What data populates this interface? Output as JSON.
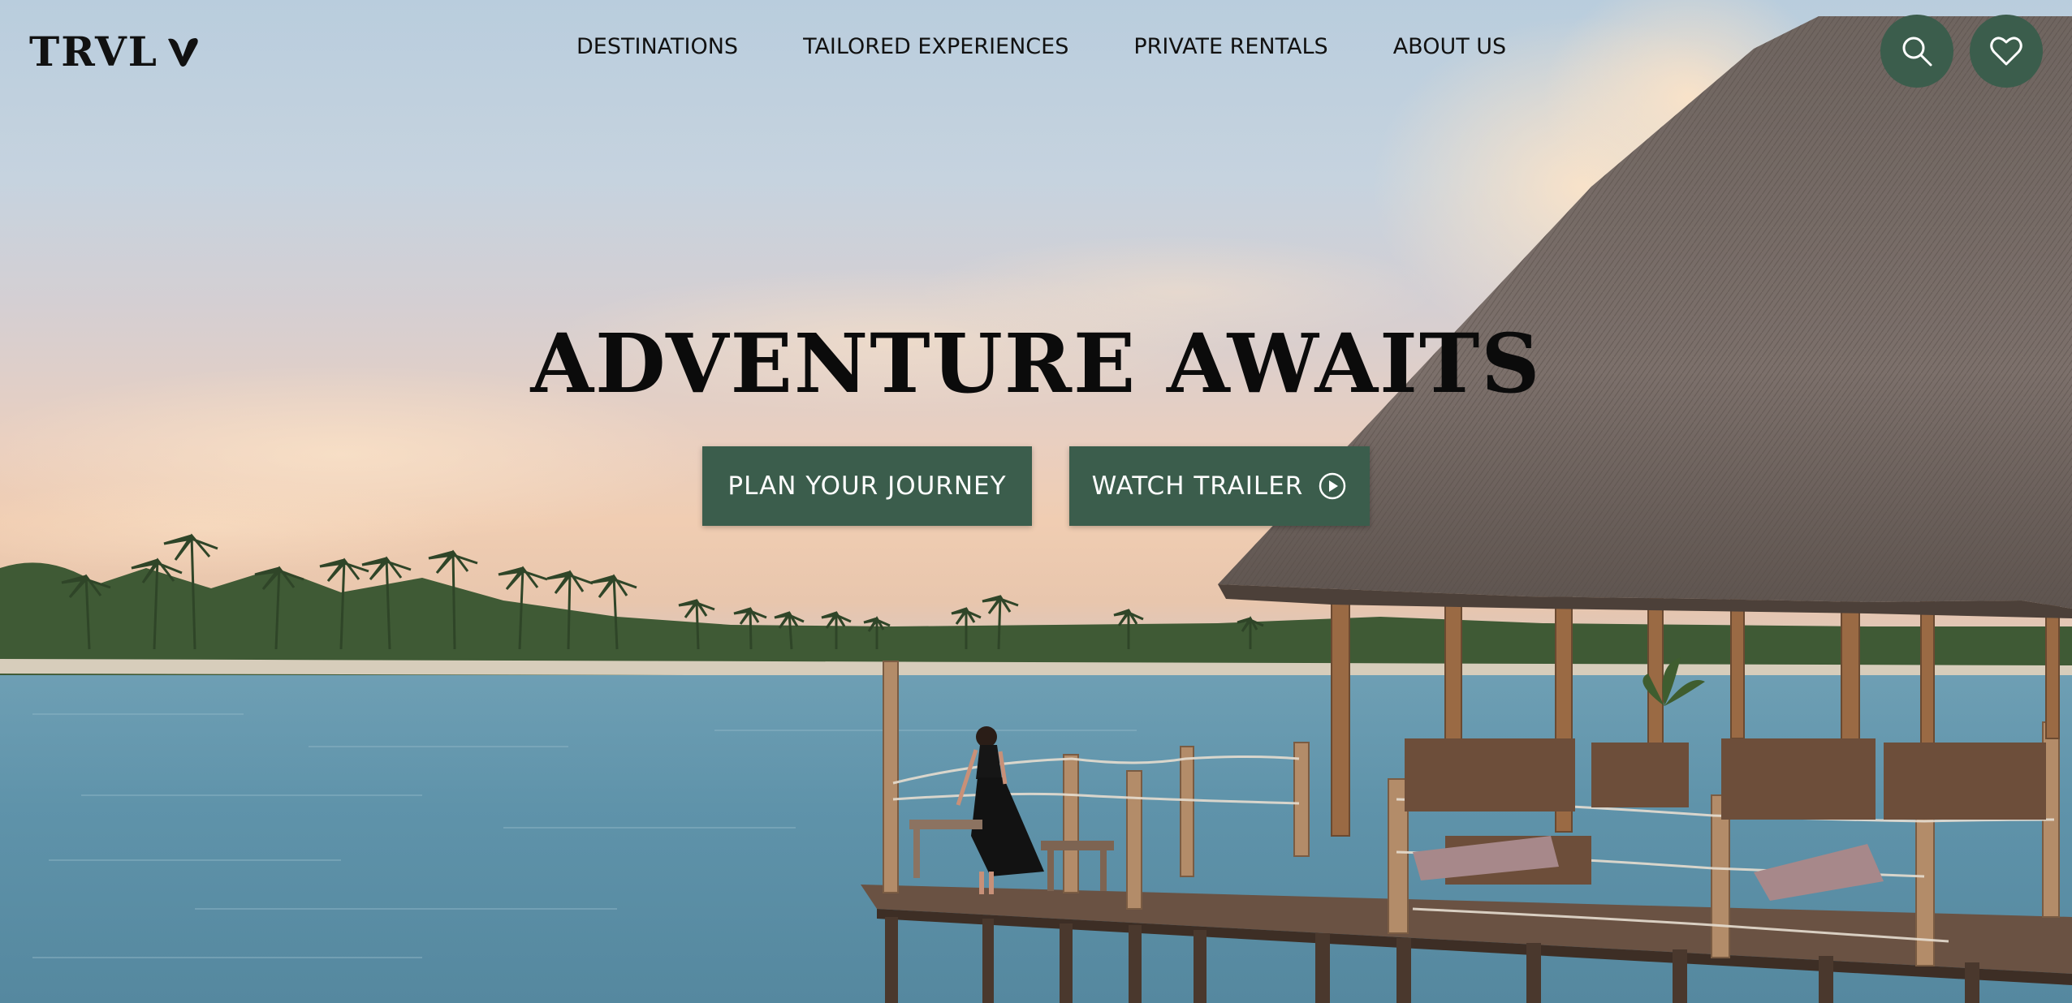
{
  "brand": {
    "logo_text": "TRVL"
  },
  "nav": {
    "items": [
      {
        "label": "DESTINATIONS"
      },
      {
        "label": "TAILORED EXPERIENCES"
      },
      {
        "label": "PRIVATE RENTALS"
      },
      {
        "label": "ABOUT US"
      }
    ]
  },
  "header_actions": {
    "search_icon": "search-icon",
    "favorites_icon": "heart-icon"
  },
  "hero": {
    "headline": "ADVENTURE AWAITS",
    "primary_cta": "PLAN YOUR JOURNEY",
    "secondary_cta": "WATCH TRAILER",
    "secondary_cta_icon": "play-circle-icon",
    "background_image": "tropical beach pier with thatched-roof hut at sunset"
  },
  "colors": {
    "accent": "#3b5d4c",
    "text": "#111111",
    "button_text": "#ffffff"
  }
}
